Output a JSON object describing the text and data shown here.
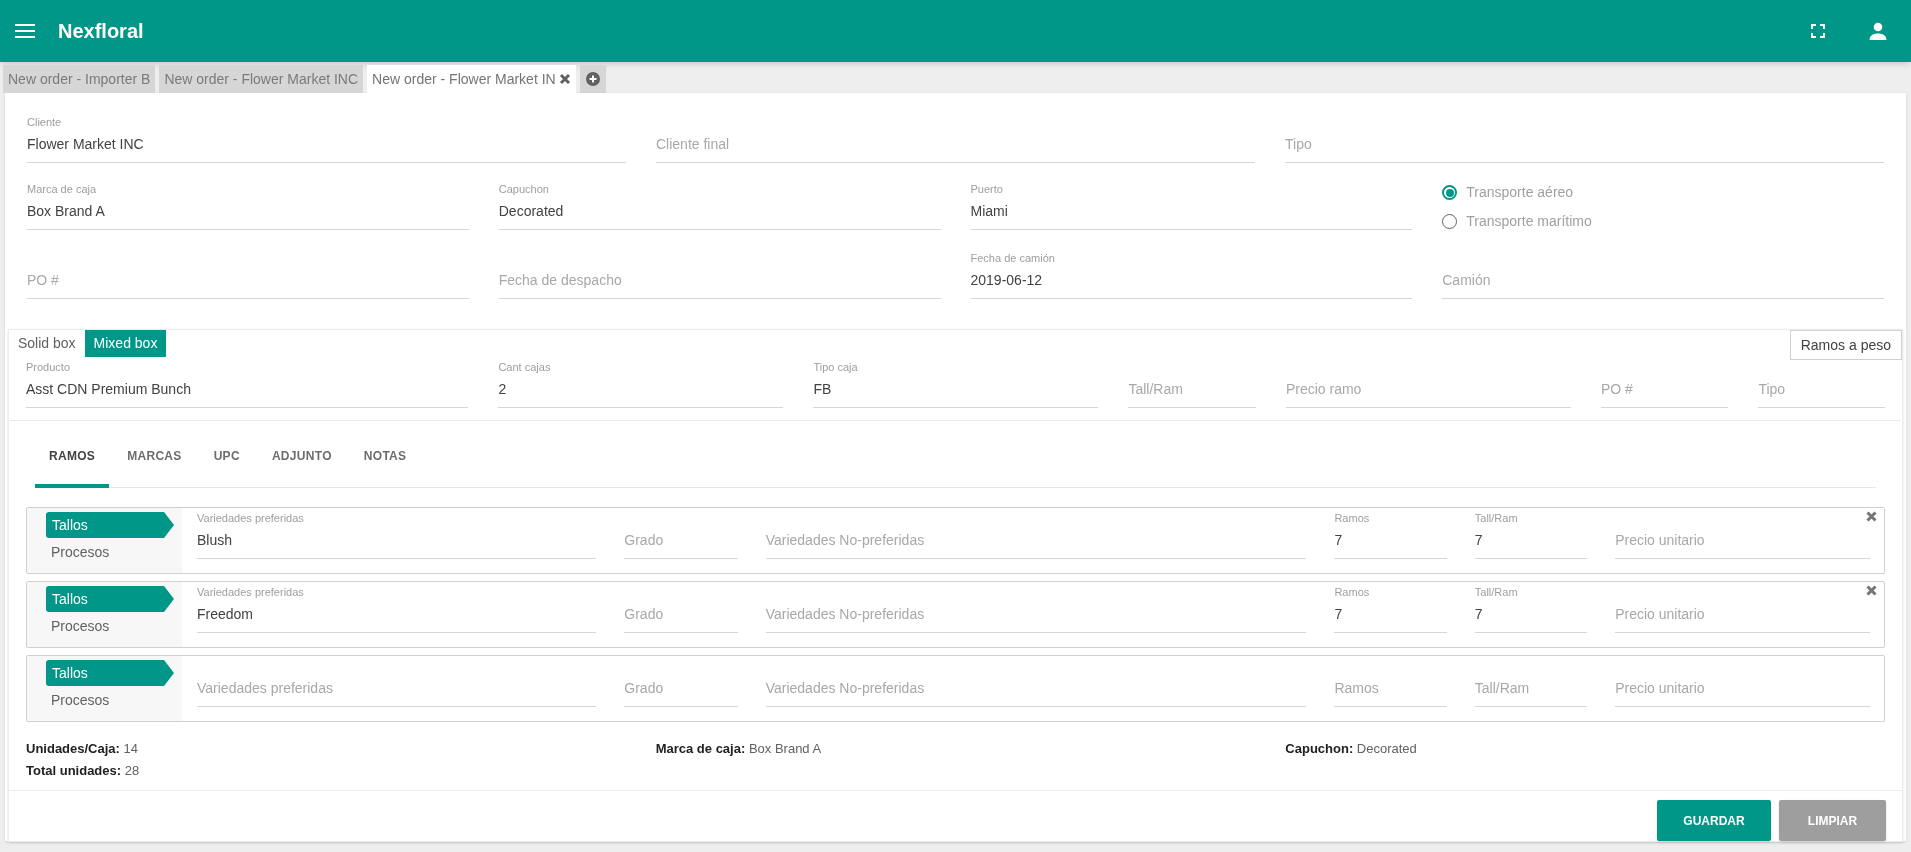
{
  "app": {
    "title": "Nexfloral"
  },
  "tabs": [
    {
      "label": "New order - Importer B",
      "selected": false,
      "closable": false
    },
    {
      "label": "New order - Flower Market INC",
      "selected": false,
      "closable": false
    },
    {
      "label": "New order - Flower Market IN",
      "selected": true,
      "closable": true
    }
  ],
  "order_rows": [
    [
      {
        "label": "Cliente",
        "value": "Flower Market INC"
      },
      {
        "placeholder": "Cliente final"
      },
      {
        "placeholder": "Tipo"
      }
    ],
    [
      {
        "label": "Marca de caja",
        "value": "Box Brand A"
      },
      {
        "label": "Capuchon",
        "value": "Decorated"
      },
      {
        "label": "Puerto",
        "value": "Miami"
      },
      {
        "kind": "radios",
        "options": [
          {
            "label": "Transporte aéreo",
            "selected": true
          },
          {
            "label": "Transporte marítimo",
            "selected": false
          }
        ]
      }
    ],
    [
      {
        "placeholder": "PO #"
      },
      {
        "placeholder": "Fecha de despacho"
      },
      {
        "label": "Fecha de camión",
        "value": "2019-06-12"
      },
      {
        "placeholder": "Camión"
      }
    ]
  ],
  "box_tabs": [
    {
      "label": "Solid box",
      "selected": false
    },
    {
      "label": "Mixed box",
      "selected": true
    }
  ],
  "weight_button": "Ramos a peso",
  "product_row": [
    {
      "label": "Producto",
      "value": "Asst CDN Premium Bunch"
    },
    {
      "label": "Cant cajas",
      "value": "2"
    },
    {
      "label": "Tipo caja",
      "value": "FB"
    },
    {
      "placeholder": "Tall/Ram"
    },
    {
      "placeholder": "Precio ramo"
    },
    {
      "placeholder": "PO #"
    },
    {
      "placeholder": "Tipo"
    }
  ],
  "sub_tabs": [
    {
      "label": "RAMOS",
      "selected": true
    },
    {
      "label": "MARCAS",
      "selected": false
    },
    {
      "label": "UPC",
      "selected": false
    },
    {
      "label": "ADJUNTO",
      "selected": false
    },
    {
      "label": "NOTAS",
      "selected": false
    }
  ],
  "ramos": [
    {
      "tag": "Tallos",
      "sub": "Procesos",
      "removable": true,
      "fields": [
        {
          "label": "Variedades preferidas",
          "value": "Blush"
        },
        {
          "placeholder": "Grado"
        },
        {
          "placeholder": "Variedades No-preferidas"
        },
        {
          "label": "Ramos",
          "value": "7"
        },
        {
          "label": "Tall/Ram",
          "value": "7"
        },
        {
          "placeholder": "Precio unitario"
        }
      ]
    },
    {
      "tag": "Tallos",
      "sub": "Procesos",
      "removable": true,
      "fields": [
        {
          "label": "Variedades preferidas",
          "value": "Freedom"
        },
        {
          "placeholder": "Grado"
        },
        {
          "placeholder": "Variedades No-preferidas"
        },
        {
          "label": "Ramos",
          "value": "7"
        },
        {
          "label": "Tall/Ram",
          "value": "7"
        },
        {
          "placeholder": "Precio unitario"
        }
      ]
    },
    {
      "tag": "Tallos",
      "sub": "Procesos",
      "removable": false,
      "fields": [
        {
          "placeholder": "Variedades preferidas"
        },
        {
          "placeholder": "Grado"
        },
        {
          "placeholder": "Variedades No-preferidas"
        },
        {
          "placeholder": "Ramos"
        },
        {
          "placeholder": "Tall/Ram"
        },
        {
          "placeholder": "Precio unitario"
        }
      ]
    }
  ],
  "summary_columns": [
    [
      {
        "label": "Unidades/Caja:",
        "value": "14"
      },
      {
        "label": "Total unidades:",
        "value": "28"
      }
    ],
    [
      {
        "label": "Marca de caja:",
        "value": "Box Brand A"
      }
    ],
    [
      {
        "label": "Capuchon:",
        "value": "Decorated"
      }
    ]
  ],
  "buttons": [
    {
      "label": "GUARDAR",
      "kind": "primary"
    },
    {
      "label": "LIMPIAR",
      "kind": "secondary"
    }
  ]
}
